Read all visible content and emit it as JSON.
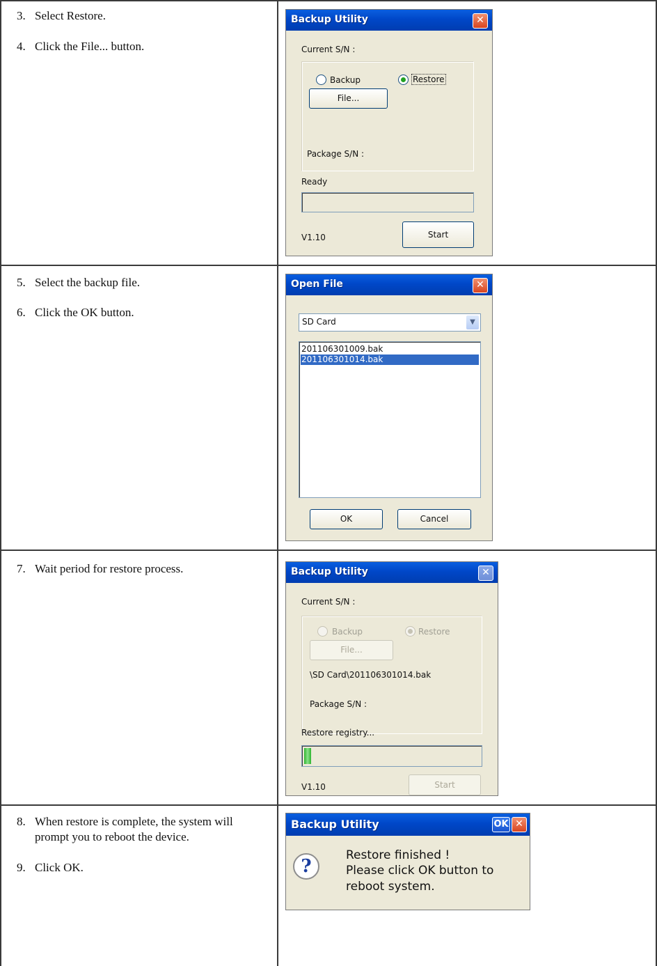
{
  "rows": [
    {
      "steps": [
        {
          "num": "3.",
          "text": "Select Restore."
        },
        {
          "num": "4.",
          "text": "Click the File... button."
        }
      ]
    },
    {
      "steps": [
        {
          "num": "5.",
          "text": "Select the backup file."
        },
        {
          "num": "6.",
          "text": "Click the OK button."
        }
      ]
    },
    {
      "steps": [
        {
          "num": "7.",
          "text": "Wait period for restore process."
        }
      ]
    },
    {
      "steps": [
        {
          "num": "8.",
          "text": "When restore is complete, the system will prompt you to reboot the device."
        },
        {
          "num": "9.",
          "text": "Click OK."
        }
      ]
    }
  ],
  "backup_dialog_1": {
    "title": "Backup Utility",
    "close_icon": "close-icon",
    "current_sn_label": "Current S/N :",
    "backup_label": "Backup",
    "restore_label": "Restore",
    "restore_selected": true,
    "file_button": "File...",
    "package_sn_label": "Package S/N :",
    "status": "Ready",
    "progress": 0,
    "version": "V1.10",
    "start_button": "Start"
  },
  "open_file_dialog": {
    "title": "Open File",
    "location": "SD Card",
    "files": [
      "201106301009.bak",
      "201106301014.bak"
    ],
    "selected_index": 1,
    "ok_button": "OK",
    "cancel_button": "Cancel"
  },
  "backup_dialog_2": {
    "title": "Backup Utility",
    "current_sn_label": "Current S/N :",
    "backup_label": "Backup",
    "restore_label": "Restore",
    "file_button": "File...",
    "file_path": "\\SD Card\\201106301014.bak",
    "package_sn_label": "Package S/N :",
    "status": "Restore registry...",
    "progress": 0.04,
    "version": "V1.10",
    "start_button": "Start"
  },
  "message_box": {
    "title": "Backup Utility",
    "ok_label": "OK",
    "icon": "question-icon",
    "message_lines": [
      "Restore finished !",
      "Please click OK button to",
      "reboot system."
    ]
  },
  "colors": {
    "titlebar": "#0047c8",
    "selection": "#316ac5",
    "progress": "#2db52d",
    "close_button": "#d94520"
  }
}
